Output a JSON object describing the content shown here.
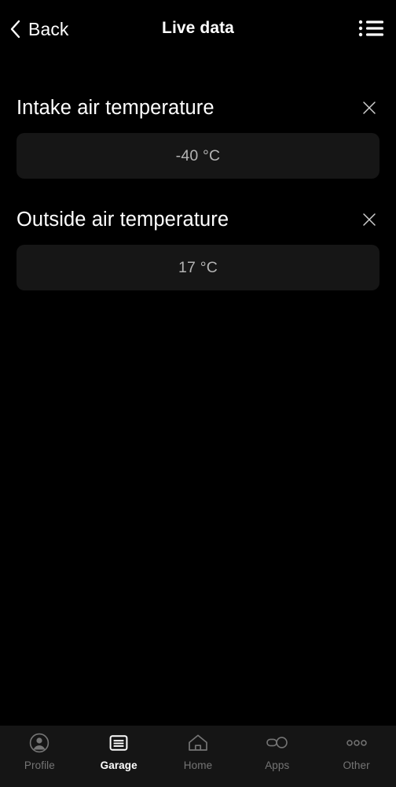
{
  "header": {
    "back_label": "Back",
    "title": "Live data",
    "back_icon": "chevron-left-icon",
    "menu_icon": "list-menu-icon"
  },
  "main": {
    "items": [
      {
        "label": "Intake air temperature",
        "value": "-40 °C",
        "close_icon": "close-icon"
      },
      {
        "label": "Outside air temperature",
        "value": "17 °C",
        "close_icon": "close-icon"
      }
    ]
  },
  "tabbar": {
    "active": "Garage",
    "items": [
      {
        "label": "Profile",
        "icon": "person-circle-icon"
      },
      {
        "label": "Garage",
        "icon": "garage-door-icon"
      },
      {
        "label": "Home",
        "icon": "house-icon"
      },
      {
        "label": "Apps",
        "icon": "key-fob-icon"
      },
      {
        "label": "Other",
        "icon": "three-dots-icon"
      }
    ]
  },
  "colors": {
    "background": "#000000",
    "card": "#161616",
    "tabbar": "#151515",
    "text_primary": "#ffffff",
    "text_value": "#b4b4b4",
    "text_muted": "#757575"
  }
}
